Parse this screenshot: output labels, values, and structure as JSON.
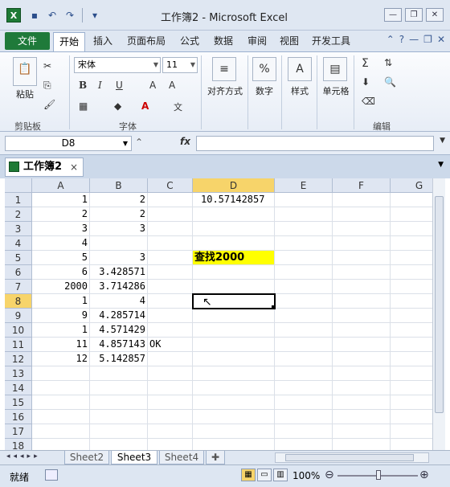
{
  "window": {
    "title": "工作簿2 - Microsoft Excel",
    "app_icon": "X"
  },
  "ribbon_tabs": {
    "file": "文件",
    "items": [
      "开始",
      "插入",
      "页面布局",
      "公式",
      "数据",
      "审阅",
      "视图",
      "开发工具"
    ]
  },
  "ribbon": {
    "clipboard": {
      "paste": "粘贴",
      "group": "剪贴板"
    },
    "font": {
      "name": "宋体",
      "size": "11",
      "bold": "B",
      "italic": "I",
      "underline": "U",
      "group": "字体"
    },
    "alignment": {
      "label": "对齐方式"
    },
    "number": {
      "label": "数字",
      "icon": "%"
    },
    "styles": {
      "label": "样式"
    },
    "cells": {
      "label": "单元格"
    },
    "editing": {
      "group": "编辑"
    }
  },
  "formula_bar": {
    "name_box": "D8",
    "fx": "fx",
    "value": ""
  },
  "workbook_tab": {
    "name": "工作簿2",
    "close": "×"
  },
  "columns": [
    "A",
    "B",
    "C",
    "D",
    "E",
    "F",
    "G"
  ],
  "active_column": "D",
  "active_row": 8,
  "rows": [
    {
      "n": "1",
      "A": "1",
      "B": "2",
      "C": "",
      "D": "10.57142857"
    },
    {
      "n": "2",
      "A": "2",
      "B": "2",
      "C": "",
      "D": ""
    },
    {
      "n": "3",
      "A": "3",
      "B": "3",
      "C": "",
      "D": ""
    },
    {
      "n": "4",
      "A": "4",
      "B": "",
      "C": "",
      "D": ""
    },
    {
      "n": "5",
      "A": "5",
      "B": "3",
      "C": "",
      "D": "查找2000"
    },
    {
      "n": "6",
      "A": "6",
      "B": "3.428571",
      "C": "",
      "D": ""
    },
    {
      "n": "7",
      "A": "2000",
      "B": "3.714286",
      "C": "",
      "D": ""
    },
    {
      "n": "8",
      "A": "1",
      "B": "4",
      "C": "",
      "D": ""
    },
    {
      "n": "9",
      "A": "9",
      "B": "4.285714",
      "C": "",
      "D": ""
    },
    {
      "n": "10",
      "A": "1",
      "B": "4.571429",
      "C": "",
      "D": ""
    },
    {
      "n": "11",
      "A": "11",
      "B": "4.857143",
      "C": "OK",
      "D": ""
    },
    {
      "n": "12",
      "A": "12",
      "B": "5.142857",
      "C": "",
      "D": ""
    },
    {
      "n": "13",
      "A": "",
      "B": "",
      "C": "",
      "D": ""
    },
    {
      "n": "14",
      "A": "",
      "B": "",
      "C": "",
      "D": ""
    },
    {
      "n": "15",
      "A": "",
      "B": "",
      "C": "",
      "D": ""
    },
    {
      "n": "16",
      "A": "",
      "B": "",
      "C": "",
      "D": ""
    },
    {
      "n": "17",
      "A": "",
      "B": "",
      "C": "",
      "D": ""
    },
    {
      "n": "18",
      "A": "",
      "B": "",
      "C": "",
      "D": ""
    }
  ],
  "sheets": [
    "Sheet2",
    "Sheet3",
    "Sheet4"
  ],
  "active_sheet": "Sheet3",
  "status": {
    "ready": "就绪",
    "zoom": "100%"
  },
  "colors": {
    "highlight": "#ffff00",
    "file_tab": "#1f7a3a",
    "active_header": "#f7d46a"
  }
}
